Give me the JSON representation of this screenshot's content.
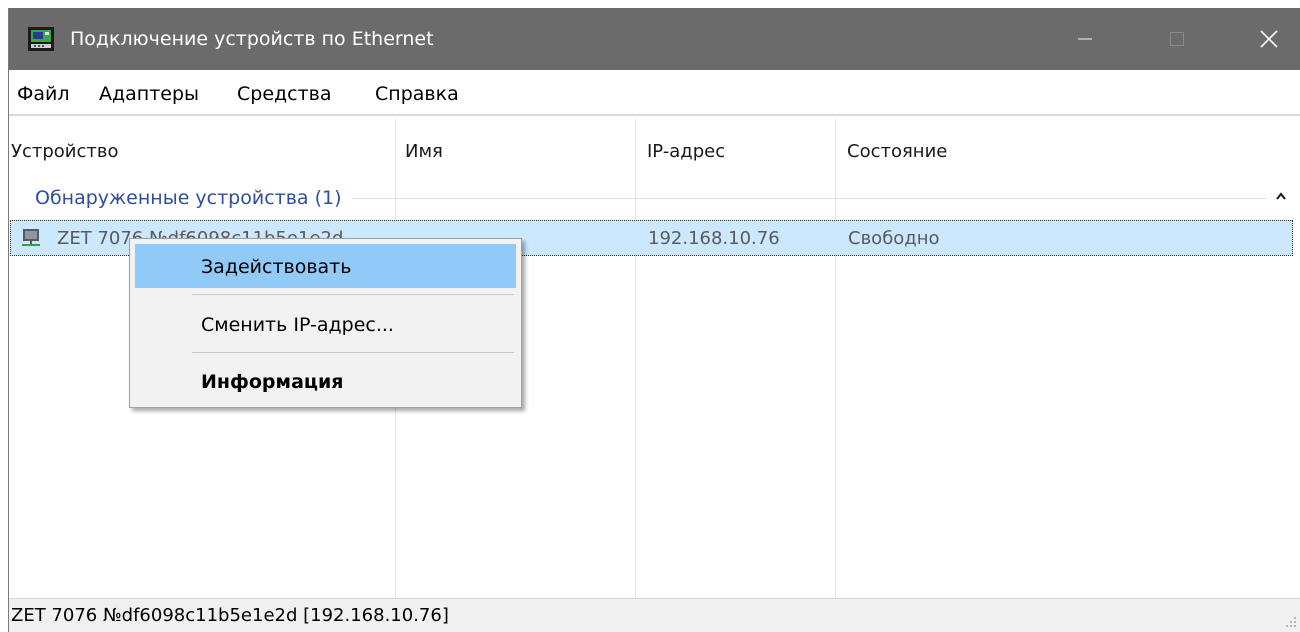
{
  "window": {
    "title": "Подключение устройств по Ethernet"
  },
  "menu": {
    "items": [
      "Файл",
      "Адаптеры",
      "Средства",
      "Справка"
    ]
  },
  "list": {
    "columns": [
      "Устройство",
      "Имя",
      "IP-адрес",
      "Состояние"
    ],
    "group": {
      "title": "Обнаруженные устройства (1)"
    },
    "rows": [
      {
        "device": "ZET 7076 №df6098c11b5e1e2d",
        "name": "",
        "ip": "192.168.10.76",
        "state": "Свободно"
      }
    ]
  },
  "context_menu": {
    "items": [
      {
        "label": "Задействовать",
        "highlighted": true
      },
      {
        "label": "Сменить IP-адрес..."
      },
      {
        "label": "Информация",
        "bold": true
      }
    ]
  },
  "statusbar": {
    "text": "ZET 7076 №df6098c11b5e1e2d [192.168.10.76]"
  },
  "colors": {
    "titlebar": "#6b6b6b",
    "selection": "#cce8ff",
    "menu_highlight": "#91c9f7",
    "group_title": "#2e4f9c"
  },
  "icons": {
    "app": "network-device-icon",
    "row": "network-device-icon",
    "minimize": "minimize-icon",
    "maximize": "maximize-icon",
    "close": "close-icon",
    "collapse": "chevron-up-icon"
  }
}
